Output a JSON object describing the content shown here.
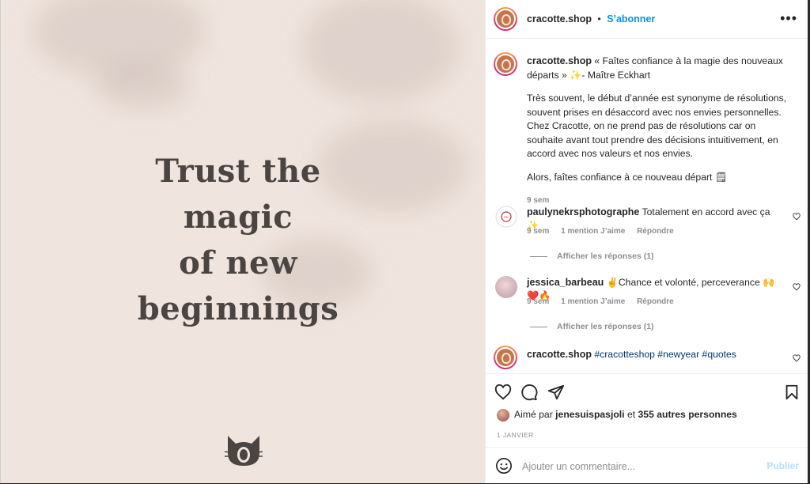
{
  "post_image": {
    "quote_lines": [
      "Trust the",
      "magic",
      "of new",
      "beginnings"
    ],
    "logo_icon": "cat-face-icon",
    "background_color": "#f0e5de",
    "text_color": "#4a4543"
  },
  "header": {
    "username": "cracotte.shop",
    "separator": "•",
    "follow_label": "S’abonner",
    "more_icon": "more-horizontal-icon"
  },
  "caption": {
    "username": "cracotte.shop",
    "first_line": "« Faîtes confiance à la magie des nouveaux départs » ✨- Maître Eckhart",
    "paragraph": "Très souvent, le début d’année est synonyme de résolutions, souvent prises en désaccord avec nos envies personnelles. Chez Cracotte, on ne prend pas de résolutions car on souhaite avant tout prendre des décisions intuitivement, en accord avec nos valeurs et nos envies.",
    "closing": "Alors, faîtes confiance à ce nouveau départ 🗒",
    "time": "9 sem"
  },
  "comments": [
    {
      "username": "paulynekrsphotographe",
      "text": "Totalement en accord avec ça ✨",
      "time": "9 sem",
      "likes": "1 mention J’aime",
      "reply": "Répondre",
      "view_replies": "Afficher les réponses (1)"
    },
    {
      "username": "jessica_barbeau",
      "text": "✌Chance et volonté, perceverance 🙌❤️🔥",
      "time": "9 sem",
      "likes": "1 mention J’aime",
      "reply": "Répondre",
      "view_replies": "Afficher les réponses (1)"
    },
    {
      "username": "cracotte.shop",
      "hashtags": "#cracotteshop #newyear #quotes"
    }
  ],
  "actions": {
    "like_icon": "heart-icon",
    "comment_icon": "comment-icon",
    "share_icon": "send-icon",
    "save_icon": "bookmark-icon",
    "liked_by_prefix": "Aimé par",
    "liked_by_user": "jenesuispasjoli",
    "liked_by_middle": "et",
    "liked_by_count": "355 autres personnes",
    "date": "1 JANVIER"
  },
  "add_comment": {
    "emoji_icon": "smiley-icon",
    "placeholder": "Ajouter un commentaire...",
    "publish_label": "Publier"
  },
  "colors": {
    "accent": "#0095f6",
    "hashtag": "#00376b",
    "muted": "#8e8e8e",
    "publish_disabled": "#b2dffc"
  }
}
